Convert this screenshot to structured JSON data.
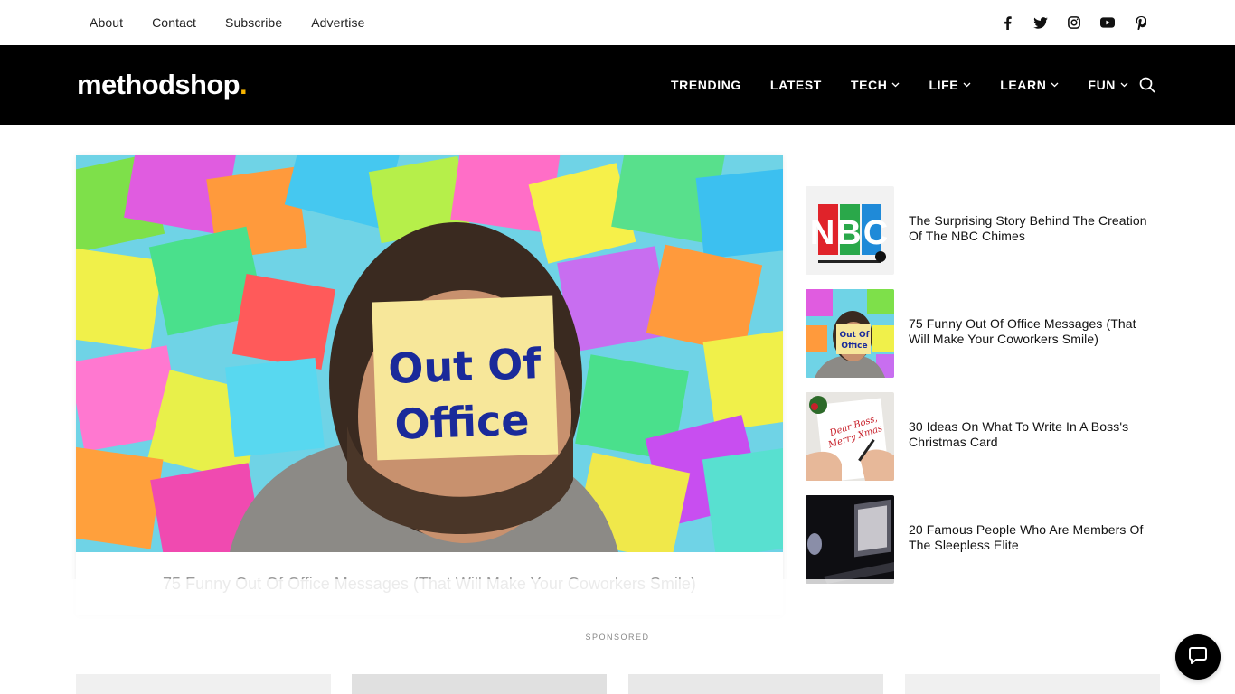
{
  "topbar": {
    "links": [
      "About",
      "Contact",
      "Subscribe",
      "Advertise"
    ],
    "social_icons": [
      "facebook-icon",
      "twitter-icon",
      "instagram-icon",
      "youtube-icon",
      "pinterest-icon"
    ]
  },
  "header": {
    "logo_text": "methodshop",
    "logo_dot": ".",
    "accent_color": "#f6b400",
    "nav": [
      {
        "label": "TRENDING",
        "dropdown": false
      },
      {
        "label": "LATEST",
        "dropdown": false
      },
      {
        "label": "TECH",
        "dropdown": true
      },
      {
        "label": "LIFE",
        "dropdown": true
      },
      {
        "label": "LEARN",
        "dropdown": true
      },
      {
        "label": "FUN",
        "dropdown": true
      }
    ]
  },
  "hero": {
    "image_text_line1": "Out Of",
    "image_text_line2": "Office",
    "caption": "75 Funny Out Of Office Messages (That Will Make Your Coworkers Smile)"
  },
  "sidebar": {
    "items": [
      {
        "title": "The Surprising Story Behind The Creation Of The NBC Chimes",
        "thumb": "nbc"
      },
      {
        "title": "75 Funny Out Of Office Messages (That Will Make Your Coworkers Smile)",
        "thumb": "office"
      },
      {
        "title": "30 Ideas On What To Write In A Boss's Christmas Card",
        "thumb": "card"
      },
      {
        "title": "20 Famous People Who Are Members Of The Sleepless Elite",
        "thumb": "laptop"
      }
    ],
    "nbc_thumb_text": "NBC",
    "office_thumb_line1": "Out Of",
    "office_thumb_line2": "Office",
    "card_thumb_line1": "Dear Boss,",
    "card_thumb_line2": "Merry Xmas"
  },
  "sponsored_label": "SPONSORED"
}
